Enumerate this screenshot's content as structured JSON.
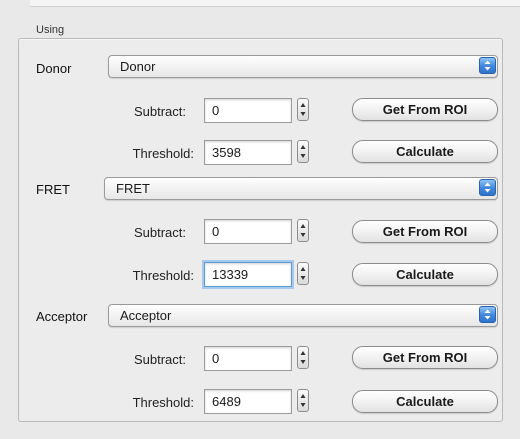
{
  "group_title": "Using",
  "sections": [
    {
      "label": "Donor",
      "channel": "Donor",
      "subtract_label": "Subtract:",
      "subtract_value": "0",
      "threshold_label": "Threshold:",
      "threshold_value": "3598",
      "get_roi_label": "Get From ROI",
      "calculate_label": "Calculate"
    },
    {
      "label": "FRET",
      "channel": "FRET",
      "subtract_label": "Subtract:",
      "subtract_value": "0",
      "threshold_label": "Threshold:",
      "threshold_value": "13339",
      "get_roi_label": "Get From ROI",
      "calculate_label": "Calculate"
    },
    {
      "label": "Acceptor",
      "channel": "Acceptor",
      "subtract_label": "Subtract:",
      "subtract_value": "0",
      "threshold_label": "Threshold:",
      "threshold_value": "6489",
      "get_roi_label": "Get From ROI",
      "calculate_label": "Calculate"
    }
  ],
  "colors": {
    "accent": "#3f86dc",
    "background": "#e9e9e9",
    "focus_ring": "#a7c9ef"
  },
  "icons": {
    "select_arrow": "popup-arrows-icon",
    "stepper": "stepper-arrows-icon"
  }
}
